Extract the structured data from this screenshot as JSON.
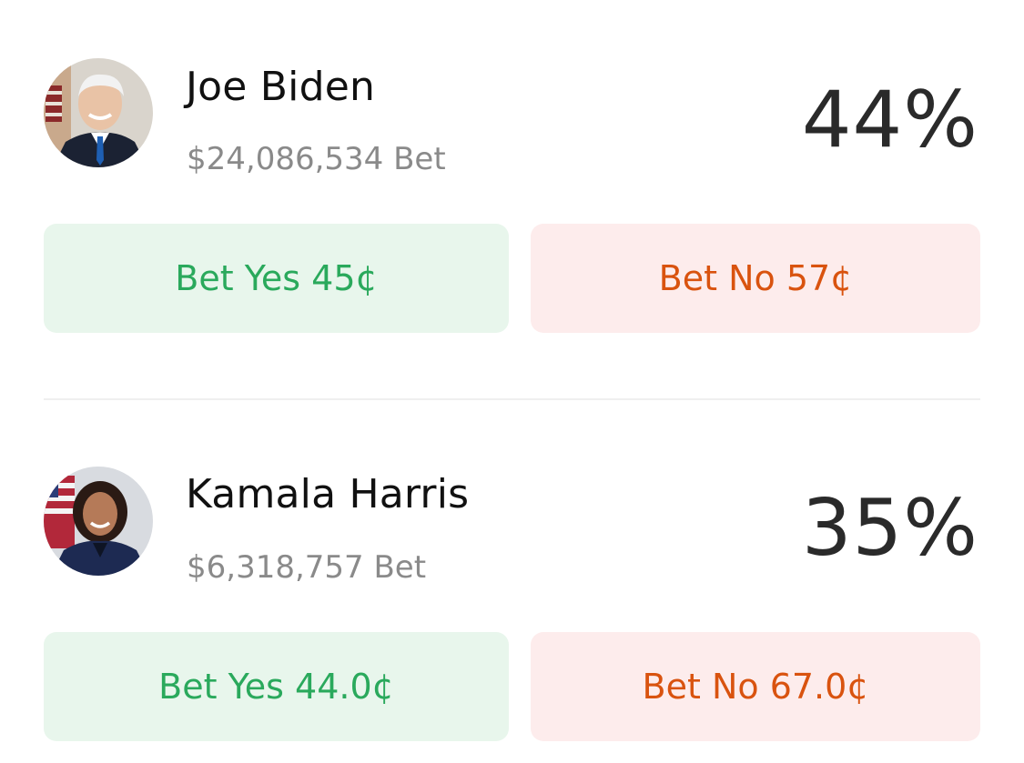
{
  "markets": [
    {
      "name": "Joe Biden",
      "volume": "$24,086,534 Bet",
      "percent": "44%",
      "yes_label": "Bet Yes 45¢",
      "no_label": "Bet No 57¢"
    },
    {
      "name": "Kamala Harris",
      "volume": "$6,318,757 Bet",
      "percent": "35%",
      "yes_label": "Bet Yes 44.0¢",
      "no_label": "Bet No 67.0¢"
    }
  ],
  "colors": {
    "yes_text": "#2aa95c",
    "yes_bg": "#e8f6ec",
    "no_text": "#d9530f",
    "no_bg": "#fdecec",
    "percent_text": "#2a2a2a",
    "volume_text": "#8a8a8a"
  }
}
